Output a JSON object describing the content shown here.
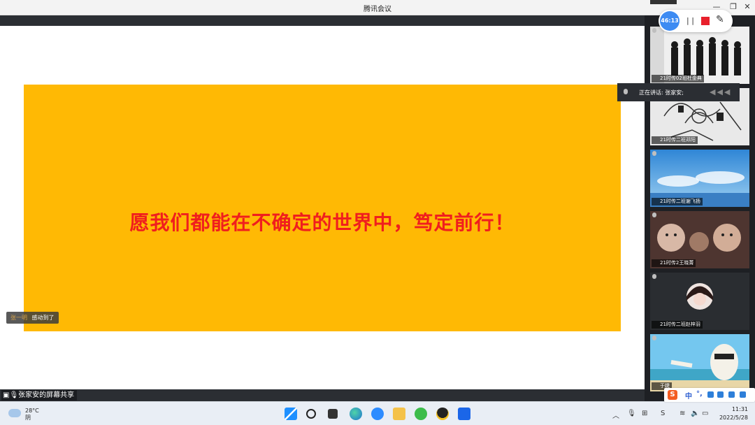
{
  "window": {
    "title": "腾讯会议"
  },
  "recording": {
    "time": "46:13",
    "pause": "| |",
    "pen": "✎"
  },
  "slide": {
    "text": "愿我们都能在不确定的世界中，笃定前行！"
  },
  "notification": {
    "who": "张一明",
    "message": "感动到了"
  },
  "sharebar": {
    "label": "张家安的屏幕共享"
  },
  "speaking": {
    "label": "正在讲话: 张家安;"
  },
  "participants": [
    {
      "name": "21时传02班杜金典",
      "bg": "#f0f0f0"
    },
    {
      "name": "21时传二班邓阳",
      "bg": "#e6e6e6"
    },
    {
      "name": "21时传二班谢飞扬",
      "bg": "#4da3e0"
    },
    {
      "name": "21时传2王晓菁",
      "bg": "#5b3d36"
    },
    {
      "name": "21时传二班赵梓羽",
      "bg": "#2a2d31"
    },
    {
      "name": "于婕",
      "bg": "#6ac5ef"
    }
  ],
  "weather": {
    "temp": "28°C",
    "desc": "阴"
  },
  "ime": {
    "lang": "中",
    "lang2": "°,"
  },
  "clock": {
    "time": "11:31",
    "date": "2022/5/28"
  },
  "colors": {
    "slide_bg": "#ffb904",
    "slide_text": "#f01e1e",
    "panel": "#1e2024",
    "accent": "#3d8bf2"
  }
}
